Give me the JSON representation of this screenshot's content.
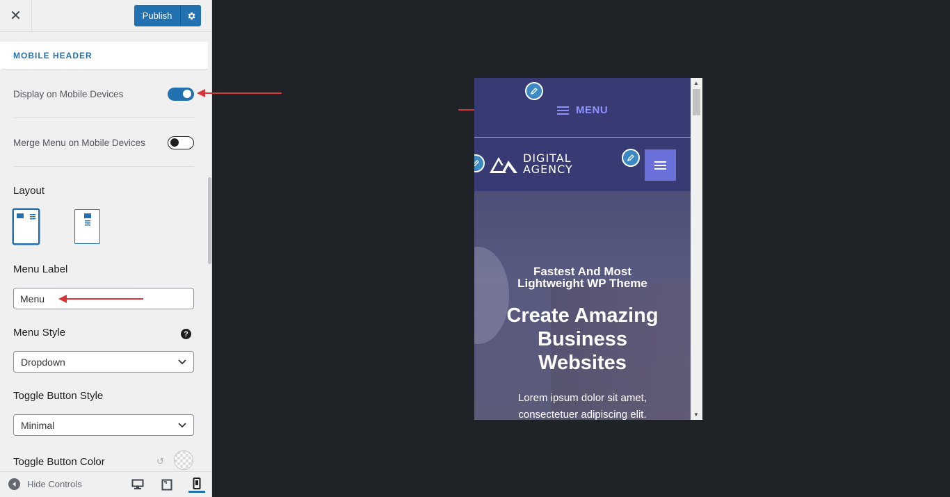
{
  "topbar": {
    "publish_label": "Publish"
  },
  "section": {
    "title": "MOBILE HEADER"
  },
  "settings": {
    "display_mobile": {
      "label": "Display on Mobile Devices",
      "enabled": true
    },
    "merge_menu": {
      "label": "Merge Menu on Mobile Devices",
      "enabled": false
    },
    "layout": {
      "label": "Layout"
    },
    "menu_label": {
      "label": "Menu Label",
      "value": "Menu"
    },
    "menu_style": {
      "label": "Menu Style",
      "value": "Dropdown"
    },
    "toggle_style": {
      "label": "Toggle Button Style",
      "value": "Minimal"
    },
    "toggle_color": {
      "label": "Toggle Button Color"
    }
  },
  "footer": {
    "hide_controls": "Hide Controls"
  },
  "preview": {
    "menu_text": "MENU",
    "logo_line1": "DIGITAL",
    "logo_line2": "AGENCY",
    "hero_subtitle_1": "Fastest And Most",
    "hero_subtitle_2": "Lightweight WP Theme",
    "hero_title_1": "Create Amazing",
    "hero_title_2": "Business",
    "hero_title_3": "Websites",
    "hero_text_1": "Lorem ipsum dolor sit amet,",
    "hero_text_2": "consectetuer adipiscing elit."
  },
  "colors": {
    "accent": "#2271b1",
    "preview_header": "#383a73",
    "menu_accent": "#8f93ff",
    "arrow": "#d63638"
  }
}
